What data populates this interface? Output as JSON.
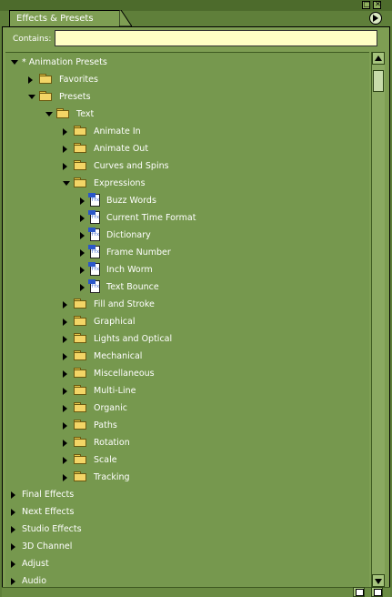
{
  "panel": {
    "tab_title": "Effects & Presets",
    "contains_label": "Contains:",
    "search_value": ""
  },
  "tree": [
    {
      "label": "* Animation Presets",
      "level": 0,
      "state": "expanded",
      "icon": "none"
    },
    {
      "label": "Favorites",
      "level": 1,
      "state": "collapsed",
      "icon": "folder"
    },
    {
      "label": "Presets",
      "level": 1,
      "state": "expanded",
      "icon": "folder"
    },
    {
      "label": "Text",
      "level": 2,
      "state": "expanded",
      "icon": "folder"
    },
    {
      "label": "Animate In",
      "level": 3,
      "state": "collapsed",
      "icon": "folder"
    },
    {
      "label": "Animate Out",
      "level": 3,
      "state": "collapsed",
      "icon": "folder"
    },
    {
      "label": "Curves and Spins",
      "level": 3,
      "state": "collapsed",
      "icon": "folder"
    },
    {
      "label": "Expressions",
      "level": 3,
      "state": "expanded",
      "icon": "folder"
    },
    {
      "label": "Buzz Words",
      "level": 4,
      "state": "collapsed",
      "icon": "preset-file"
    },
    {
      "label": "Current Time Format",
      "level": 4,
      "state": "collapsed",
      "icon": "preset-file"
    },
    {
      "label": "Dictionary",
      "level": 4,
      "state": "collapsed",
      "icon": "preset-file"
    },
    {
      "label": "Frame Number",
      "level": 4,
      "state": "collapsed",
      "icon": "preset-file"
    },
    {
      "label": "Inch Worm",
      "level": 4,
      "state": "collapsed",
      "icon": "preset-file"
    },
    {
      "label": "Text Bounce",
      "level": 4,
      "state": "collapsed",
      "icon": "preset-file"
    },
    {
      "label": "Fill and Stroke",
      "level": 3,
      "state": "collapsed",
      "icon": "folder"
    },
    {
      "label": "Graphical",
      "level": 3,
      "state": "collapsed",
      "icon": "folder"
    },
    {
      "label": "Lights and Optical",
      "level": 3,
      "state": "collapsed",
      "icon": "folder"
    },
    {
      "label": "Mechanical",
      "level": 3,
      "state": "collapsed",
      "icon": "folder"
    },
    {
      "label": "Miscellaneous",
      "level": 3,
      "state": "collapsed",
      "icon": "folder"
    },
    {
      "label": "Multi-Line",
      "level": 3,
      "state": "collapsed",
      "icon": "folder"
    },
    {
      "label": "Organic",
      "level": 3,
      "state": "collapsed",
      "icon": "folder"
    },
    {
      "label": "Paths",
      "level": 3,
      "state": "collapsed",
      "icon": "folder"
    },
    {
      "label": "Rotation",
      "level": 3,
      "state": "collapsed",
      "icon": "folder"
    },
    {
      "label": "Scale",
      "level": 3,
      "state": "collapsed",
      "icon": "folder"
    },
    {
      "label": "Tracking",
      "level": 3,
      "state": "collapsed",
      "icon": "folder"
    },
    {
      "label": "Final Effects",
      "level": 0,
      "state": "collapsed",
      "icon": "none"
    },
    {
      "label": "Next Effects",
      "level": 0,
      "state": "collapsed",
      "icon": "none"
    },
    {
      "label": "Studio Effects",
      "level": 0,
      "state": "collapsed",
      "icon": "none"
    },
    {
      "label": "3D Channel",
      "level": 0,
      "state": "collapsed",
      "icon": "none"
    },
    {
      "label": "Adjust",
      "level": 0,
      "state": "collapsed",
      "icon": "none"
    },
    {
      "label": "Audio",
      "level": 0,
      "state": "collapsed",
      "icon": "none"
    }
  ],
  "colors": {
    "panel_bg": "#7e9e53",
    "tree_bg": "#76984e",
    "input_bg": "#ffffc4",
    "folder": "#f3d566",
    "preset_icon": "#2b57c9"
  }
}
